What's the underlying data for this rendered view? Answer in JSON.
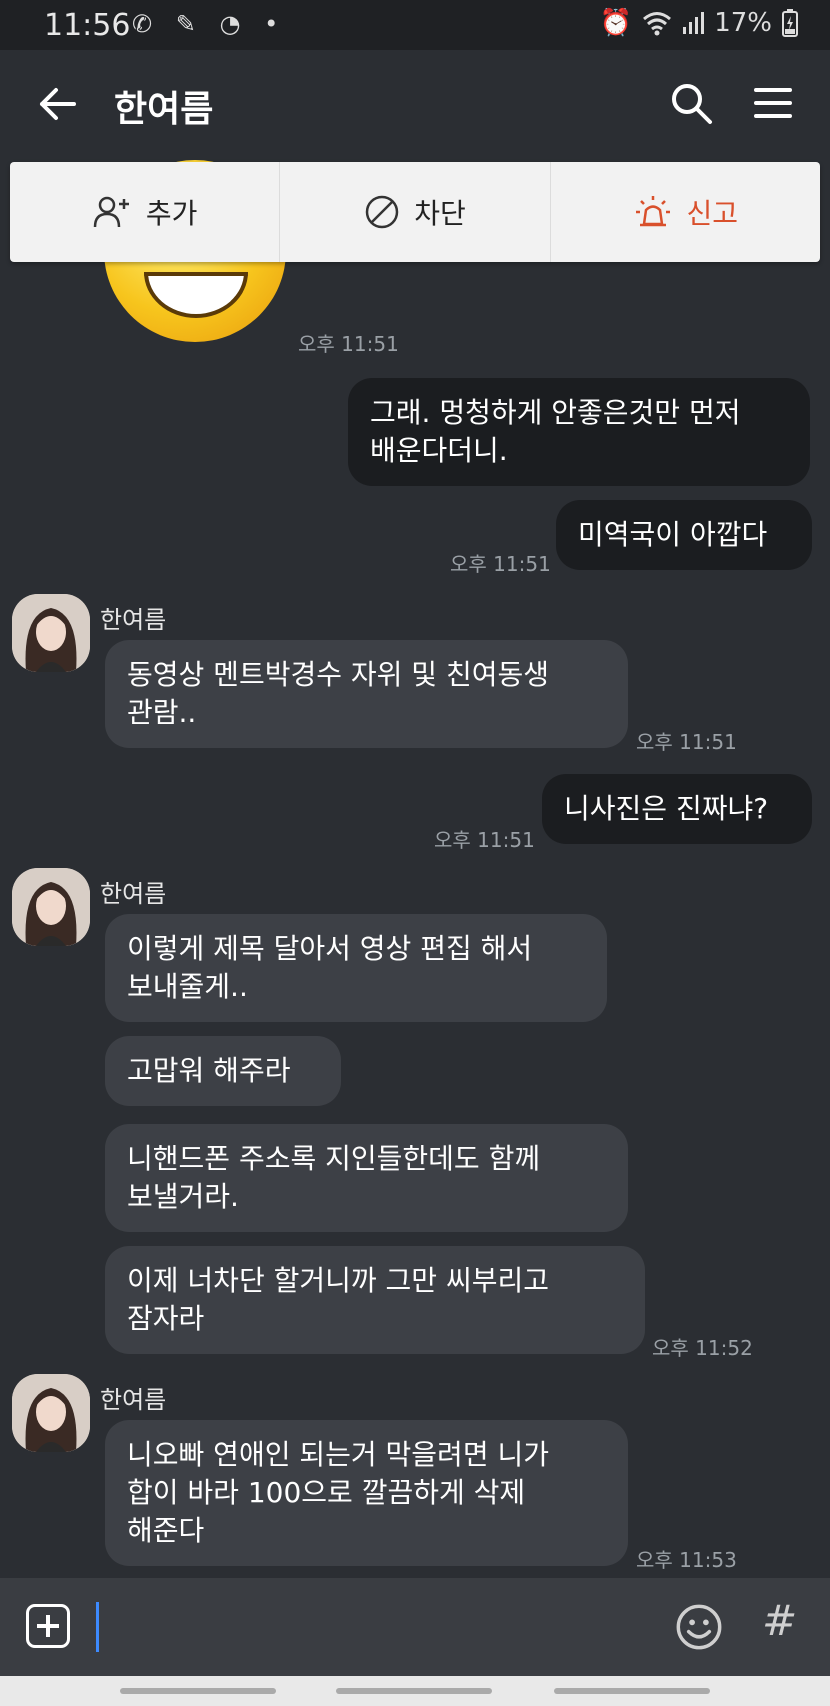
{
  "status_bar": {
    "time": "11:56",
    "battery": "17%",
    "left_icons": [
      "wifi-call-icon",
      "feather-icon",
      "gauge-icon",
      "dot"
    ],
    "right_icons": [
      "alarm-icon",
      "wifi-icon",
      "signal-icon",
      "battery-icon"
    ]
  },
  "header": {
    "title": "한여름"
  },
  "actions": {
    "add": "추가",
    "block": "차단",
    "report": "신고"
  },
  "colors": {
    "background": "#2b2e33",
    "mine_bubble": "#1b1d20",
    "theirs_bubble": "#3d4046",
    "report_accent": "#d9502c"
  },
  "messages": [
    {
      "id": "m0",
      "side": "theirs",
      "type": "sticker",
      "time": "오후 11:51"
    },
    {
      "id": "m1",
      "side": "mine",
      "text": "그래. 멍청하게 안좋은것만 먼저\n배운다더니."
    },
    {
      "id": "m2",
      "side": "mine",
      "text": "미역국이 아깝다",
      "time": "오후 11:51"
    },
    {
      "id": "m3",
      "side": "theirs",
      "sender": "한여름",
      "text": "동영상 멘트박경수 자위 및 친여동생\n관람..",
      "time": "오후 11:51"
    },
    {
      "id": "m4",
      "side": "mine",
      "text": "니사진은 진짜냐?",
      "time": "오후 11:51"
    },
    {
      "id": "m5",
      "side": "theirs",
      "sender": "한여름",
      "text": "이렇게 제목 달아서 영상 편집 해서\n보내줄게.."
    },
    {
      "id": "m6",
      "side": "theirs",
      "text": "고맙워 해주라"
    },
    {
      "id": "m7",
      "side": "theirs",
      "text": "니핸드폰 주소록 지인들한데도  함께\n보낼거라."
    },
    {
      "id": "m8",
      "side": "theirs",
      "text": "이제  너차단 할거니까 그만 씨부리고\n잠자라",
      "time": "오후 11:52"
    },
    {
      "id": "m9",
      "side": "theirs",
      "sender": "한여름",
      "text": "니오빠 연애인 되는거 막을려면 니가\n합이 바라  100으로 깔끔하게 삭제\n해준다",
      "time": "오후 11:53"
    }
  ]
}
